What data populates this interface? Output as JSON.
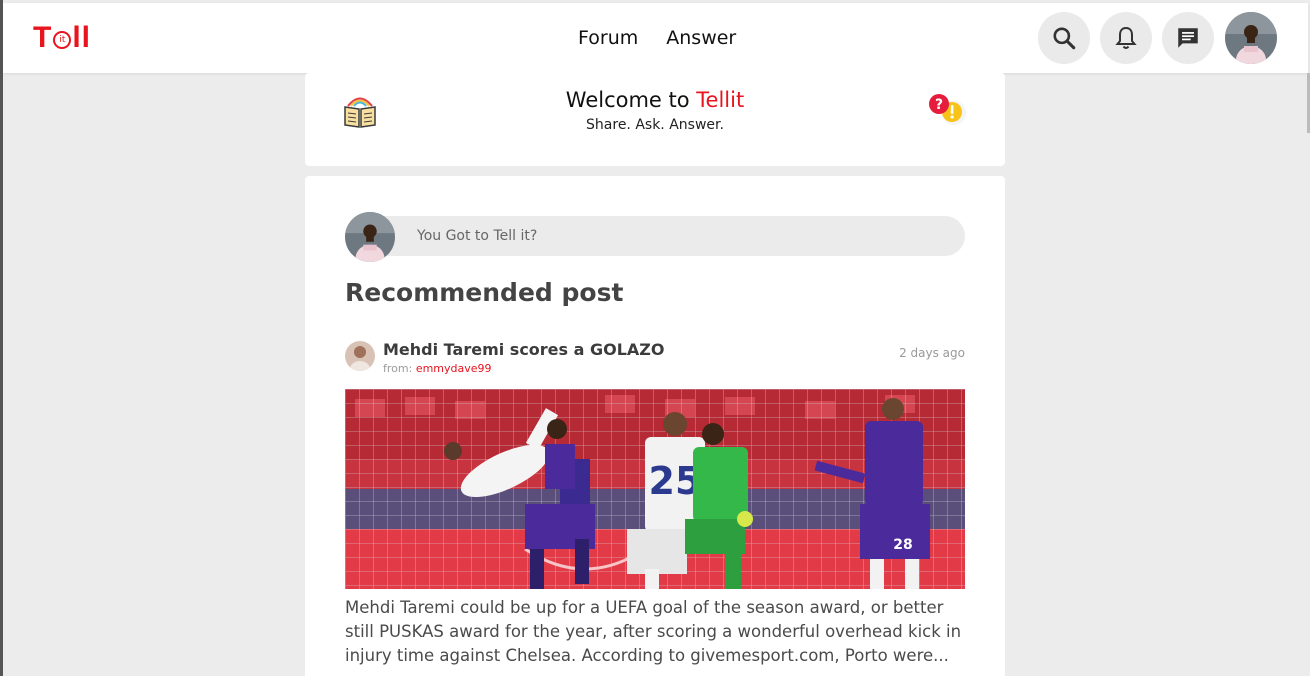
{
  "header": {
    "logo_text": "Tell",
    "logo_bubble": "it",
    "nav": [
      {
        "label": "Forum"
      },
      {
        "label": "Answer"
      }
    ],
    "icons": [
      "search-icon",
      "bell-icon",
      "message-icon"
    ]
  },
  "welcome": {
    "title_prefix": "Welcome to ",
    "title_brand": "Tellit",
    "subtitle": "Share. Ask. Answer."
  },
  "composer": {
    "placeholder": "You Got to Tell it?"
  },
  "feed": {
    "section_title": "Recommended post",
    "post": {
      "title": "Mehdi Taremi scores a GOLAZO",
      "from_label": "from: ",
      "username": "emmydave99",
      "time": "2 days ago",
      "excerpt": "Mehdi Taremi could be up for a UEFA goal of the season award, or better still PUSKAS award for the year, after scoring a wonderful overhead kick in injury time against Chelsea. According to givemesport.com, Porto were..."
    }
  },
  "colors": {
    "brand": "#e8141e",
    "background": "#ececec",
    "chelsea": "#4b2a9c",
    "porto": "#f2f2f2"
  }
}
